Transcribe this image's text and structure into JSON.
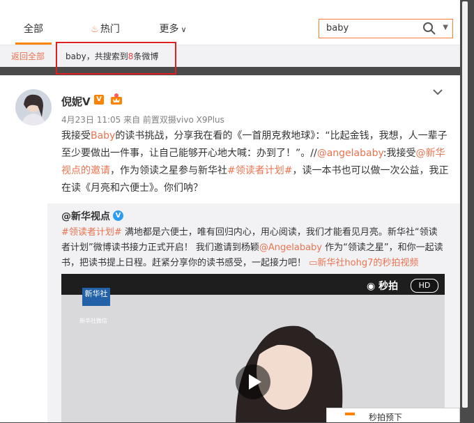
{
  "tabs": [
    {
      "label": "全部"
    },
    {
      "label": "热门"
    },
    {
      "label": "更多"
    }
  ],
  "search": {
    "value": "baby"
  },
  "crumb": {
    "back": "返回全部",
    "result_prefix": "baby，共搜索到",
    "result_count": "8",
    "result_suffix": "条微博"
  },
  "post": {
    "author": "倪妮V",
    "meta": "4月23日 11:05 来自 前置双摄vivo X9Plus",
    "segments": [
      {
        "t": "我接受",
        "h": false
      },
      {
        "t": "Baby",
        "h": true
      },
      {
        "t": "的读书挑战，分享我在看的《一首朋克救地球》：“比起金钱，我想，人一辈子至少要做出一件事，让自己能够开心地大喊：办到了！”。//",
        "h": false
      },
      {
        "t": "@angelababy",
        "h": true
      },
      {
        "t": ":我接受",
        "h": false
      },
      {
        "t": "@新华视点的邀请",
        "h": true
      },
      {
        "t": "，作为领读之星参与新华社",
        "h": false
      },
      {
        "t": "#领读者计划#",
        "h": true
      },
      {
        "t": "，读一本书也可以做一次公益，我正在读《月亮和六便士》。你们呐？",
        "h": false
      }
    ]
  },
  "retweet": {
    "author": "@新华视点",
    "segments": [
      {
        "t": "#领读者计划#",
        "h": true
      },
      {
        "t": " 满地都是六便士，唯有回归内心，用心阅读，我们才能看见月亮。新华社“领读者计划”微博读书接力正式开启！ 我们邀请到杨颖",
        "h": false
      },
      {
        "t": "@Angelababy",
        "h": true
      },
      {
        "t": " 作为“领读之星”，和你一起读书，把读书提上日程。赶紧分享你的读书感受，一起接力吧！ ",
        "h": false
      },
      {
        "t": "▭新华社hohg7的秒拍视频",
        "h": true
      }
    ]
  },
  "video": {
    "logo": "新华社",
    "logo_sub": "新华社微信",
    "brand": "秒拍",
    "hd": "HD"
  },
  "tooltip": {
    "label": "秒拍预下"
  }
}
